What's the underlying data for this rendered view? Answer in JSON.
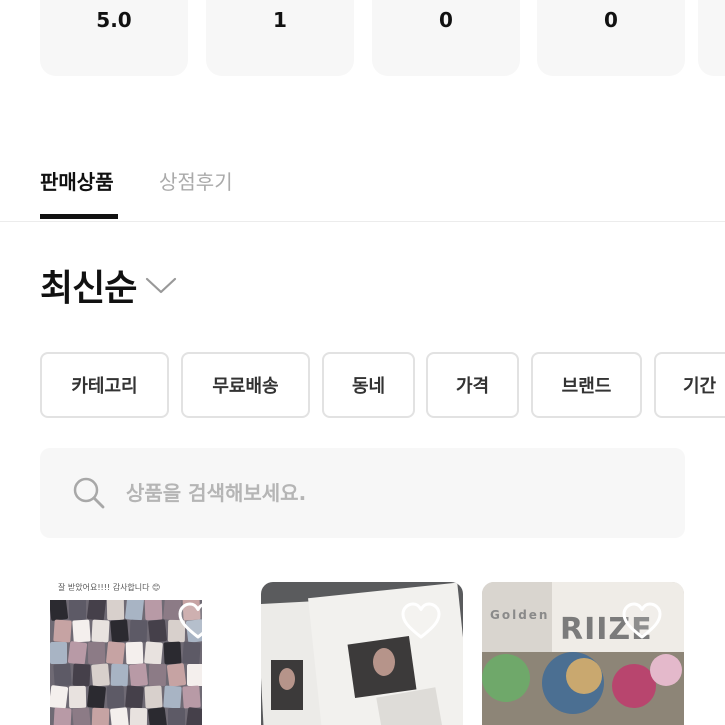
{
  "stats": {
    "items": [
      {
        "value": "5.0"
      },
      {
        "value": "1"
      },
      {
        "value": "0"
      },
      {
        "value": "0"
      }
    ]
  },
  "tabs": [
    {
      "label": "판매상품",
      "active": true
    },
    {
      "label": "상점후기",
      "active": false
    }
  ],
  "sort": {
    "label": "최신순",
    "icon": "chevron-down-icon"
  },
  "filters": [
    {
      "label": "카테고리"
    },
    {
      "label": "무료배송"
    },
    {
      "label": "동네"
    },
    {
      "label": "가격"
    },
    {
      "label": "브랜드"
    },
    {
      "label": "기간"
    }
  ],
  "search": {
    "placeholder": "상품을 검색해보세요.",
    "icon": "search-icon"
  },
  "products": [
    {
      "image_caption": "잘 받았어요!!!! 감사합니다 😊",
      "wish_icon": "heart-outline-icon"
    },
    {
      "wish_icon": "heart-outline-icon"
    },
    {
      "image_text_top": "Golden Age",
      "image_text_logo": "RIIZE",
      "wish_icon": "heart-outline-icon"
    }
  ],
  "colors": {
    "text_primary": "#111111",
    "text_muted": "#aaaaaa",
    "surface": "#f7f7f7",
    "border": "#e2e2e2"
  }
}
